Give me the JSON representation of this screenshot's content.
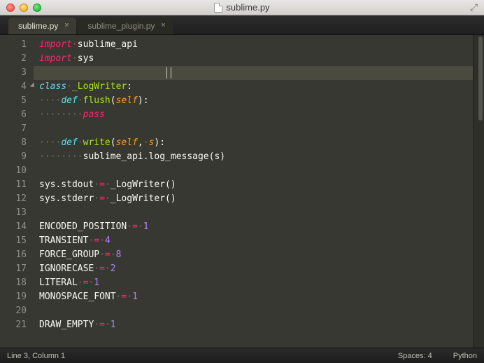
{
  "window": {
    "title": "sublime.py"
  },
  "tabs": [
    {
      "label": "sublime.py",
      "active": true
    },
    {
      "label": "sublime_plugin.py",
      "active": false
    }
  ],
  "code_lines": [
    {
      "n": 1,
      "seg": [
        [
          "kw-red",
          "import"
        ],
        [
          "dots",
          "·"
        ],
        [
          "plain",
          "sublime_api"
        ]
      ]
    },
    {
      "n": 2,
      "seg": [
        [
          "kw-red",
          "import"
        ],
        [
          "dots",
          "·"
        ],
        [
          "plain",
          "sys"
        ]
      ]
    },
    {
      "n": 3,
      "seg": [],
      "hl": true,
      "cursor": true
    },
    {
      "n": 4,
      "fold": true,
      "seg": [
        [
          "kw-blue",
          "class"
        ],
        [
          "dots",
          "·"
        ],
        [
          "fn-green",
          "_LogWriter"
        ],
        [
          "plain",
          ":"
        ]
      ]
    },
    {
      "n": 5,
      "seg": [
        [
          "dots",
          "····"
        ],
        [
          "kw-blue",
          "def"
        ],
        [
          "dots",
          "·"
        ],
        [
          "fn-green",
          "flush"
        ],
        [
          "plain",
          "("
        ],
        [
          "param",
          "self"
        ],
        [
          "plain",
          "):"
        ]
      ]
    },
    {
      "n": 6,
      "seg": [
        [
          "dots",
          "········"
        ],
        [
          "kw-red",
          "pass"
        ]
      ]
    },
    {
      "n": 7,
      "seg": []
    },
    {
      "n": 8,
      "seg": [
        [
          "dots",
          "····"
        ],
        [
          "kw-blue",
          "def"
        ],
        [
          "dots",
          "·"
        ],
        [
          "fn-green",
          "write"
        ],
        [
          "plain",
          "("
        ],
        [
          "param",
          "self"
        ],
        [
          "plain",
          ","
        ],
        [
          "dots",
          "·"
        ],
        [
          "param",
          "s"
        ],
        [
          "plain",
          "):"
        ]
      ]
    },
    {
      "n": 9,
      "seg": [
        [
          "dots",
          "········"
        ],
        [
          "plain",
          "sublime_api.log_message(s)"
        ]
      ]
    },
    {
      "n": 10,
      "seg": []
    },
    {
      "n": 11,
      "seg": [
        [
          "plain",
          "sys.stdout"
        ],
        [
          "dots",
          "·"
        ],
        [
          "op-red",
          "="
        ],
        [
          "dots",
          "·"
        ],
        [
          "plain",
          "_LogWriter()"
        ]
      ]
    },
    {
      "n": 12,
      "seg": [
        [
          "plain",
          "sys.stderr"
        ],
        [
          "dots",
          "·"
        ],
        [
          "op-red",
          "="
        ],
        [
          "dots",
          "·"
        ],
        [
          "plain",
          "_LogWriter()"
        ]
      ]
    },
    {
      "n": 13,
      "seg": []
    },
    {
      "n": 14,
      "seg": [
        [
          "plain",
          "ENCODED_POSITION"
        ],
        [
          "dots",
          "·"
        ],
        [
          "op-red",
          "="
        ],
        [
          "dots",
          "·"
        ],
        [
          "num",
          "1"
        ]
      ]
    },
    {
      "n": 15,
      "seg": [
        [
          "plain",
          "TRANSIENT"
        ],
        [
          "dots",
          "·"
        ],
        [
          "op-red",
          "="
        ],
        [
          "dots",
          "·"
        ],
        [
          "num",
          "4"
        ]
      ]
    },
    {
      "n": 16,
      "seg": [
        [
          "plain",
          "FORCE_GROUP"
        ],
        [
          "dots",
          "·"
        ],
        [
          "op-red",
          "="
        ],
        [
          "dots",
          "·"
        ],
        [
          "num",
          "8"
        ]
      ]
    },
    {
      "n": 17,
      "seg": [
        [
          "plain",
          "IGNORECASE"
        ],
        [
          "dots",
          "·"
        ],
        [
          "op-red",
          "="
        ],
        [
          "dots",
          "·"
        ],
        [
          "num",
          "2"
        ]
      ]
    },
    {
      "n": 18,
      "seg": [
        [
          "plain",
          "LITERAL"
        ],
        [
          "dots",
          "·"
        ],
        [
          "op-red",
          "="
        ],
        [
          "dots",
          "·"
        ],
        [
          "num",
          "1"
        ]
      ]
    },
    {
      "n": 19,
      "seg": [
        [
          "plain",
          "MONOSPACE_FONT"
        ],
        [
          "dots",
          "·"
        ],
        [
          "op-red",
          "="
        ],
        [
          "dots",
          "·"
        ],
        [
          "num",
          "1"
        ]
      ]
    },
    {
      "n": 20,
      "seg": []
    },
    {
      "n": 21,
      "seg": [
        [
          "plain",
          "DRAW_EMPTY"
        ],
        [
          "dots",
          "·"
        ],
        [
          "op-red",
          "="
        ],
        [
          "dots",
          "·"
        ],
        [
          "num",
          "1"
        ]
      ]
    }
  ],
  "status": {
    "left": "Line 3, Column 1",
    "spaces": "Spaces: 4",
    "lang": "Python"
  }
}
